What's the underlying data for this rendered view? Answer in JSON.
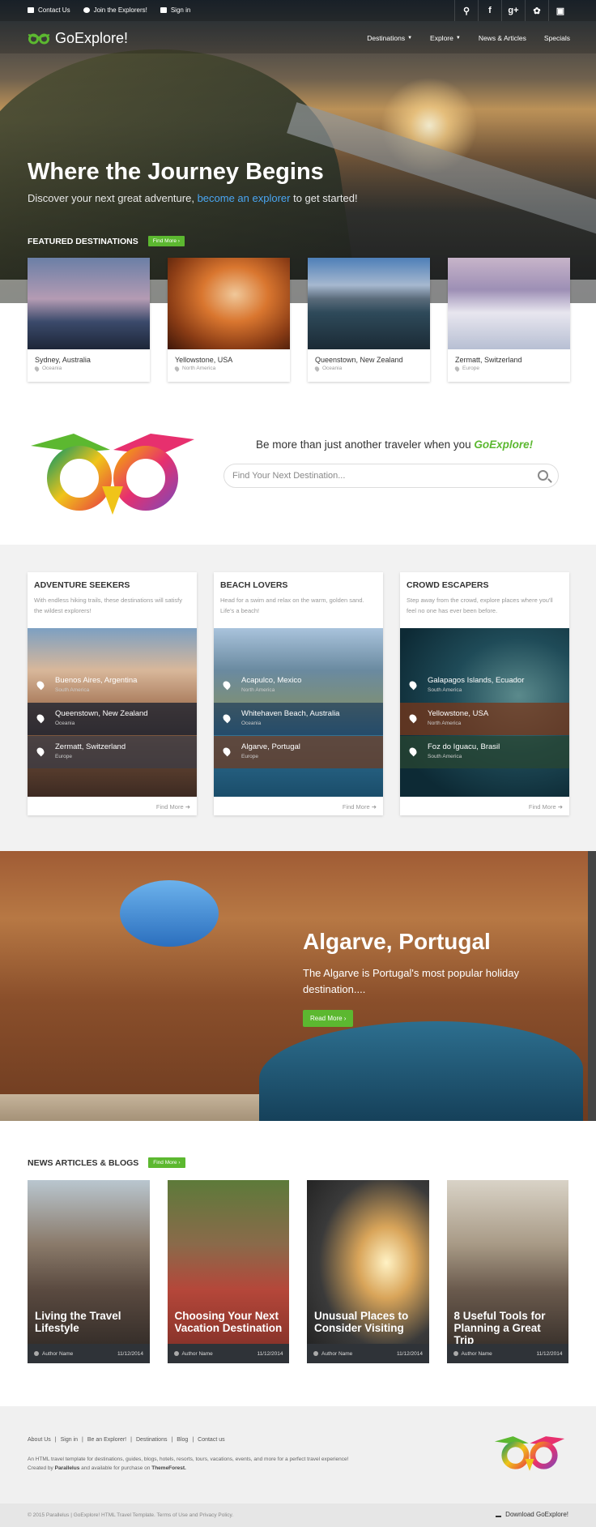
{
  "topbar": {
    "contact": "Contact Us",
    "join": "Join the Explorers!",
    "signin": "Sign in"
  },
  "brand": {
    "name": "GoExplore!"
  },
  "nav": {
    "items": [
      "Destinations",
      "Explore",
      "News & Articles",
      "Specials"
    ]
  },
  "hero": {
    "title": "Where the Journey Begins",
    "sub_before": "Discover your next great adventure, ",
    "sub_link": "become an explorer",
    "sub_after": " to get started!"
  },
  "featured": {
    "heading": "FEATURED DESTINATIONS",
    "button": "Find More",
    "cards": [
      {
        "name": "Sydney, Australia",
        "region": "Oceania"
      },
      {
        "name": "Yellowstone, USA",
        "region": "North America"
      },
      {
        "name": "Queenstown, New Zealand",
        "region": "Oceania"
      },
      {
        "name": "Zermatt, Switzerland",
        "region": "Europe"
      }
    ]
  },
  "promo": {
    "text_before": "Be more than just another traveler when you ",
    "text_brand": "GoExplore!",
    "placeholder": "Find Your Next Destination..."
  },
  "categories": [
    {
      "title": "ADVENTURE SEEKERS",
      "desc": "With endless hiking trails, these destinations will satisfy the wildest explorers!",
      "items": [
        {
          "name": "Buenos Aires, Argentina",
          "region": "South America"
        },
        {
          "name": "Queenstown, New Zealand",
          "region": "Oceania"
        },
        {
          "name": "Zermatt, Switzerland",
          "region": "Europe"
        }
      ],
      "more": "Find More"
    },
    {
      "title": "BEACH LOVERS",
      "desc": "Head for a swim and relax on the warm, golden sand. Life's a beach!",
      "items": [
        {
          "name": "Acapulco, Mexico",
          "region": "North America"
        },
        {
          "name": "Whitehaven Beach, Australia",
          "region": "Oceania"
        },
        {
          "name": "Algarve, Portugal",
          "region": "Europe"
        }
      ],
      "more": "Find More"
    },
    {
      "title": "CROWD ESCAPERS",
      "desc": "Step away from the crowd, explore places where you'll feel no one has ever been before.",
      "items": [
        {
          "name": "Galapagos Islands, Ecuador",
          "region": "South America"
        },
        {
          "name": "Yellowstone, USA",
          "region": "North America"
        },
        {
          "name": "Foz do Iguacu, Brasil",
          "region": "South America"
        }
      ],
      "more": "Find More"
    }
  ],
  "algarve": {
    "title": "Algarve, Portugal",
    "text": "The Algarve is Portugal's most popular holiday destination....",
    "button": "Read More"
  },
  "news": {
    "heading": "NEWS ARTICLES & BLOGS",
    "button": "Find More",
    "articles": [
      {
        "title": "Living the Travel Lifestyle",
        "author": "Author Name",
        "date": "11/12/2014"
      },
      {
        "title": "Choosing Your Next Vacation Destination",
        "author": "Author Name",
        "date": "11/12/2014"
      },
      {
        "title": "Unusual Places to Consider Visiting",
        "author": "Author Name",
        "date": "11/12/2014"
      },
      {
        "title": "8 Useful Tools for Planning a Great Trip",
        "author": "Author Name",
        "date": "11/12/2014"
      }
    ]
  },
  "footer": {
    "links": [
      "About Us",
      "|",
      "Sign in",
      "|",
      "Be an Explorer!",
      "|",
      "Destinations",
      "|",
      "Blog",
      "|",
      "Contact us"
    ],
    "desc": "An HTML travel template for destinations, guides, blogs, hotels, resorts, tours, vacations, events, and more for a perfect travel experience!",
    "created": "Created by ",
    "author": "Parallelus",
    "avail": " and available for purchase on ",
    "market": "ThemeForest.",
    "copyright": "© 2015 Parallelus | GoExplore! HTML Travel Template. Terms of Use and Privacy Policy.",
    "download": "Download GoExplore!"
  },
  "colors": {
    "accent": "#5cb830",
    "link": "#4aa6f2"
  }
}
